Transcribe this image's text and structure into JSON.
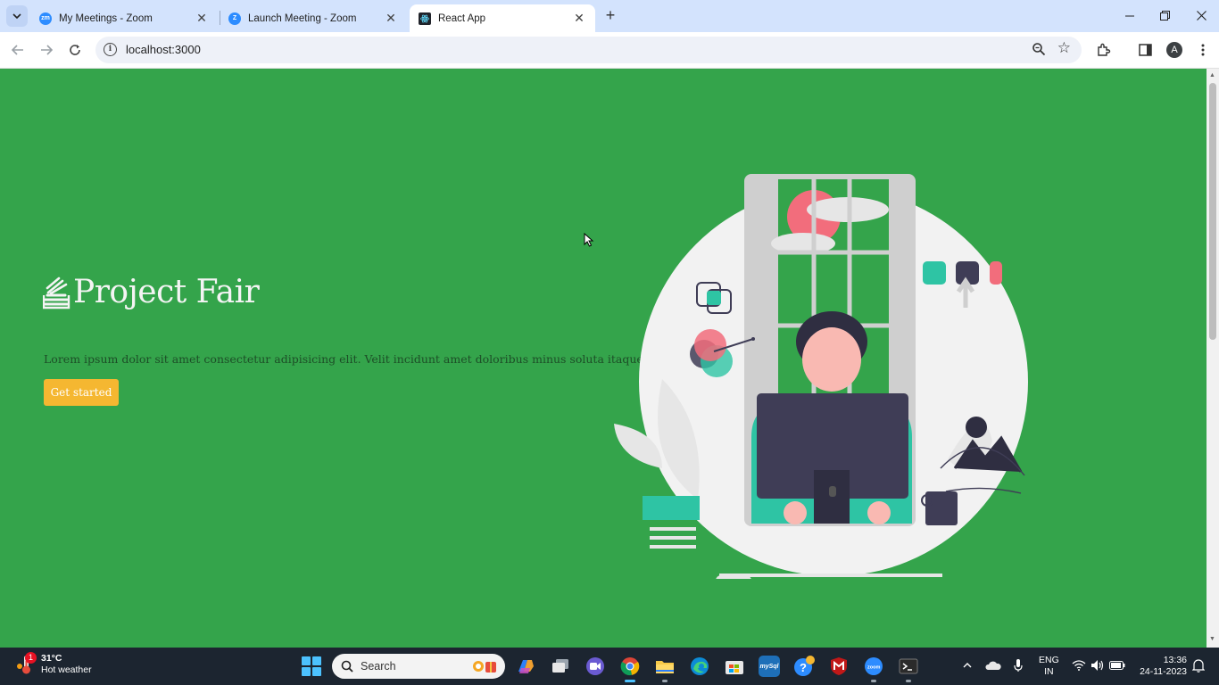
{
  "browser": {
    "tabs": [
      {
        "title": "My Meetings - Zoom",
        "favicon": "zoom-icon",
        "active": false
      },
      {
        "title": "Launch Meeting - Zoom",
        "favicon": "zoom-icon",
        "active": false
      },
      {
        "title": "React App",
        "favicon": "react-icon",
        "active": true
      }
    ],
    "new_tab_glyph": "+",
    "address": {
      "url": "localhost:3000"
    },
    "profile_initial": "A"
  },
  "page": {
    "background": "#34a44b",
    "brand": "Project Fair",
    "description": "Lorem ipsum dolor sit amet consectetur adipisicing elit. Velit incidunt amet doloribus minus soluta itaque",
    "cta_label": "Get started",
    "cta_color": "#f5b731"
  },
  "taskbar": {
    "weather": {
      "temp": "31°C",
      "condition": "Hot weather",
      "alert_count": "1"
    },
    "search_label": "Search",
    "pinned_apps": [
      "copilot-icon",
      "task-view-icon",
      "meet-icon",
      "chrome-icon",
      "file-explorer-icon",
      "edge-icon",
      "store-icon",
      "mysql-icon",
      "help-icon",
      "mcafee-icon",
      "zoom-icon",
      "terminal-icon"
    ],
    "language": {
      "line1": "ENG",
      "line2": "IN"
    },
    "clock": {
      "time": "13:36",
      "date": "24-11-2023"
    }
  }
}
